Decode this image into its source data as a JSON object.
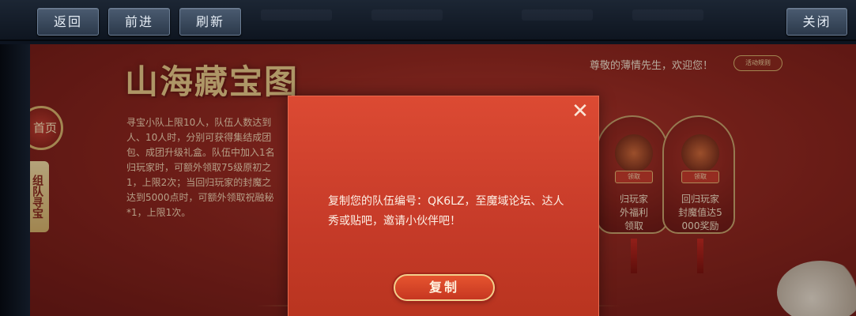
{
  "nav": {
    "back": "返回",
    "forward": "前进",
    "refresh": "刷新",
    "close": "关闭"
  },
  "page": {
    "title": "山海藏宝图",
    "home_tab": "首页",
    "team_tab": "组队寻宝",
    "greeting": "尊敬的薄情先生，欢迎您！",
    "activity_rules": "活动规则",
    "rules_lines": [
      "寻宝小队上限10人，队伍人数达到",
      "人、10人时，分别可获得集结成团",
      "包、成团升级礼盒。队伍中加入1名",
      "归玩家时，可额外领取75级原初之",
      "1，上限2次；当回归玩家的封魔之",
      "达到5000点时，可额外领取祝融秘",
      "*1，上限1次。"
    ],
    "lanterns": [
      {
        "label": "领取",
        "text_lines": [
          "归玩家",
          "外福利",
          "领取"
        ]
      },
      {
        "label": "领取",
        "text_lines": [
          "回归玩家",
          "封魔值达5",
          "000奖励"
        ]
      }
    ]
  },
  "modal": {
    "message": "复制您的队伍编号：QK6LZ，至魔域论坛、达人秀或贴吧，邀请小伙伴吧！",
    "copy_button": "复制",
    "close_glyph": "✕"
  },
  "colors": {
    "modal_bg": "#d5422f",
    "page_bg": "#922820",
    "gold": "#d9b36d",
    "nav_btn": "#3a4a5e"
  }
}
